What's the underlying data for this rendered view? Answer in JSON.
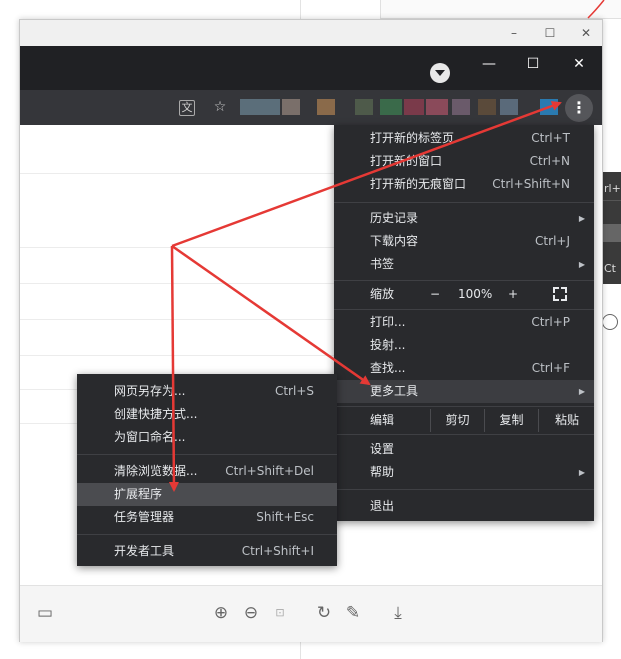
{
  "outer_window": {
    "minimize": "–",
    "maximize": "☐",
    "close": "✕"
  },
  "chrome_window": {
    "tab_search_icon": "tab-search-icon",
    "minimize": "—",
    "maximize": "☐",
    "close": "✕"
  },
  "toolbar": {
    "translate_icon": "translate-icon",
    "bookmark_star": "☆",
    "menu_icon": "⋮"
  },
  "main_menu": {
    "items": [
      {
        "label": "打开新的标签页",
        "shortcut": "Ctrl+T"
      },
      {
        "label": "打开新的窗口",
        "shortcut": "Ctrl+N"
      },
      {
        "label": "打开新的无痕窗口",
        "shortcut": "Ctrl+Shift+N"
      },
      {
        "label": "历史记录",
        "shortcut": ""
      },
      {
        "label": "下载内容",
        "shortcut": "Ctrl+J"
      },
      {
        "label": "书签",
        "shortcut": ""
      },
      {
        "label": "缩放",
        "shortcut": ""
      },
      {
        "label": "打印...",
        "shortcut": "Ctrl+P"
      },
      {
        "label": "投射...",
        "shortcut": ""
      },
      {
        "label": "查找...",
        "shortcut": "Ctrl+F"
      },
      {
        "label": "更多工具",
        "shortcut": ""
      },
      {
        "label": "编辑",
        "shortcut": ""
      },
      {
        "label": "设置",
        "shortcut": ""
      },
      {
        "label": "帮助",
        "shortcut": ""
      },
      {
        "label": "退出",
        "shortcut": ""
      }
    ],
    "zoom": {
      "minus": "−",
      "value": "100%",
      "plus": "+"
    },
    "edit": {
      "cut": "剪切",
      "copy": "复制",
      "paste": "粘贴"
    }
  },
  "submenu": {
    "items": [
      {
        "label": "网页另存为...",
        "shortcut": "Ctrl+S"
      },
      {
        "label": "创建快捷方式...",
        "shortcut": ""
      },
      {
        "label": "为窗口命名...",
        "shortcut": ""
      },
      {
        "label": "清除浏览数据...",
        "shortcut": "Ctrl+Shift+Del"
      },
      {
        "label": "扩展程序",
        "shortcut": ""
      },
      {
        "label": "任务管理器",
        "shortcut": "Shift+Esc"
      },
      {
        "label": "开发者工具",
        "shortcut": "Ctrl+Shift+I"
      }
    ]
  },
  "background_window": {
    "strip_text_1": "rl+",
    "strip_text_2": "Ct"
  },
  "colors": {
    "arrow": "#e53935",
    "menu_bg": "#292a2d",
    "highlight": "#3c3d41"
  }
}
